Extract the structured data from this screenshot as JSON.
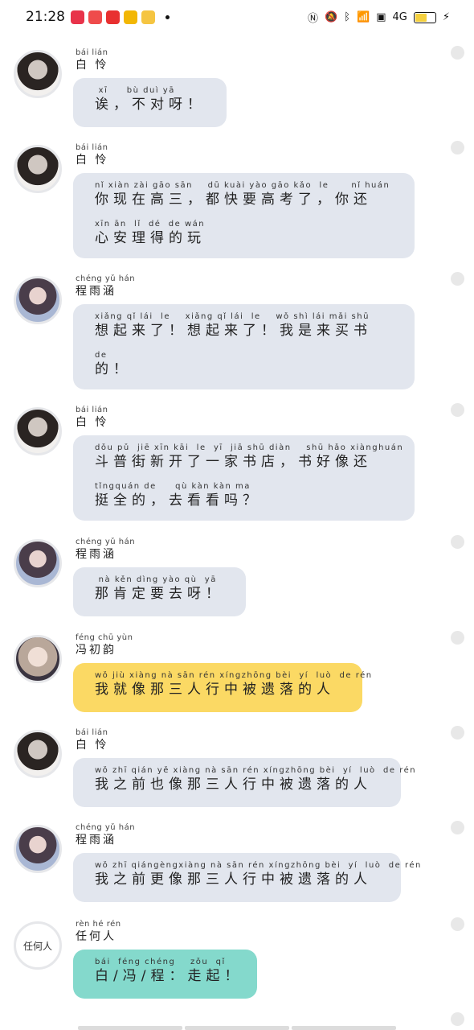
{
  "status_bar": {
    "time": "21:28",
    "network_label": "4G",
    "app_colors": [
      "#e8334a",
      "#e8334a",
      "#e83030",
      "#f2b705",
      "#f5c542"
    ],
    "battery_fraction": 0.65
  },
  "messages": [
    {
      "speaker_pinyin": "bái lián",
      "speaker": "白 怜",
      "avatar": "bailian",
      "bubble_color": "gray",
      "lines": [
        {
          "py": " xī     bù duì yā",
          "hz": "诶，不对呀！"
        }
      ]
    },
    {
      "speaker_pinyin": "bái lián",
      "speaker": "白 怜",
      "avatar": "bailian",
      "bubble_color": "gray",
      "lines": [
        {
          "py": "nǐ xiàn zài gāo sān    dū kuài yào gāo kǎo  le      nǐ huán",
          "hz": "你现在高三，都快要高考了，你还"
        },
        {
          "py": "xīn ān  lǐ  dé  de wán",
          "hz": "心安理得的玩"
        }
      ]
    },
    {
      "speaker_pinyin": "chéng yǔ hán",
      "speaker": "程雨涵",
      "avatar": "chengyuhan",
      "bubble_color": "gray",
      "lines": [
        {
          "py": "xiǎng qǐ lái  le    xiǎng qǐ lái  le    wǒ shì lái mǎi shū",
          "hz": "想起来了！想起来了！我是来买书"
        },
        {
          "py": "de",
          "hz": "的！"
        }
      ]
    },
    {
      "speaker_pinyin": "bái lián",
      "speaker": "白 怜",
      "avatar": "bailian",
      "bubble_color": "gray",
      "lines": [
        {
          "py": "dǒu pǔ  jiē xīn kāi  le  yī  jiā shū diàn    shū hǎo xiànghuán",
          "hz": "斗普街新开了一家书店，书好像还"
        },
        {
          "py": "tǐngquán de     qù kàn kàn ma",
          "hz": "挺全的，去看看吗？"
        }
      ]
    },
    {
      "speaker_pinyin": "chéng yǔ hán",
      "speaker": "程雨涵",
      "avatar": "chengyuhan",
      "bubble_color": "gray",
      "lines": [
        {
          "py": " nà kěn dìng yào qù  yā",
          "hz": "那肯定要去呀！"
        }
      ]
    },
    {
      "speaker_pinyin": "féng chū yùn",
      "speaker": "冯初韵",
      "avatar": "fengchuyun",
      "bubble_color": "yellow",
      "lines": [
        {
          "py": "wǒ jiù xiàng nà sān rén xíngzhōng bèi  yí  luò  de rén",
          "hz": "我就像那三人行中被遗落的人"
        }
      ]
    },
    {
      "speaker_pinyin": "bái lián",
      "speaker": "白 怜",
      "avatar": "bailian",
      "bubble_color": "gray",
      "lines": [
        {
          "py": "wǒ zhī qián yě xiàng nà sān rén xíngzhōng bèi  yí  luò  de rén",
          "hz": "我之前也像那三人行中被遗落的人"
        }
      ]
    },
    {
      "speaker_pinyin": "chéng yǔ hán",
      "speaker": "程雨涵",
      "avatar": "chengyuhan",
      "bubble_color": "gray",
      "lines": [
        {
          "py": "wǒ zhī qiángèngxiàng nà sān rén xíngzhōng bèi  yí  luò  de rén",
          "hz": "我之前更像那三人行中被遗落的人"
        }
      ]
    },
    {
      "speaker_pinyin": "rèn hé rén",
      "speaker": "任何人",
      "avatar": "renheren",
      "avatar_text": "任何人",
      "bubble_color": "teal",
      "lines": [
        {
          "py": "bái  féng chéng    zǒu  qǐ",
          "hz": "白/冯/程：走起！"
        }
      ]
    }
  ]
}
